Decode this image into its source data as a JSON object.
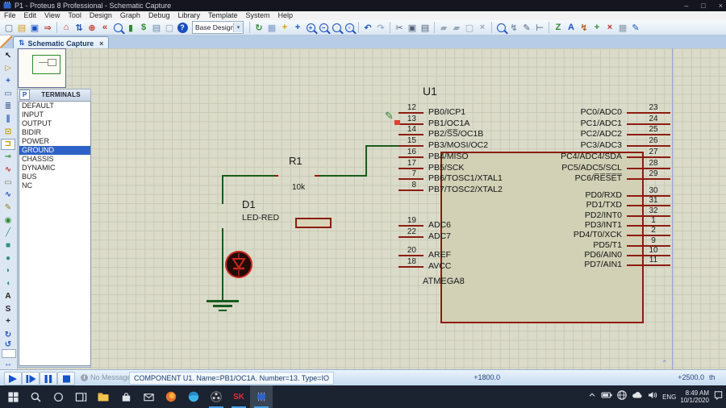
{
  "window": {
    "title": "P1 - Proteus 8 Professional - Schematic Capture",
    "controls": {
      "minimize": "–",
      "maximize": "□",
      "close": "×"
    }
  },
  "menus": [
    "File",
    "Edit",
    "View",
    "Tool",
    "Design",
    "Graph",
    "Debug",
    "Library",
    "Template",
    "System",
    "Help"
  ],
  "toolbar": {
    "design_combo": "Base Design",
    "combo_arrow": "▾",
    "groups_a": [
      [
        {
          "name": "new-design",
          "g": "▢",
          "c": "#5a6a7a"
        },
        {
          "name": "open-design",
          "g": "▤",
          "c": "#d89a10"
        },
        {
          "name": "save-design",
          "g": "▣",
          "c": "#1a4fc0"
        },
        {
          "name": "import-section",
          "g": "⇒",
          "c": "#c03028"
        }
      ],
      [
        {
          "name": "home-page",
          "g": "⌂",
          "c": "#c03028"
        },
        {
          "name": "new-sheet",
          "g": "⇅",
          "c": "#1a4fc0"
        },
        {
          "name": "center-at-cursor",
          "g": "⊕",
          "c": "#c03028"
        },
        {
          "name": "goto-sheet",
          "g": "«",
          "c": "#c03028"
        },
        {
          "name": "find-part",
          "t": "mag",
          "i": ""
        },
        {
          "name": "material-list",
          "g": "▮",
          "c": "#2f8a2f"
        },
        {
          "name": "bill-of-materials",
          "g": "$",
          "c": "#2f8a2f"
        },
        {
          "name": "electrical-rule-check",
          "g": "▤",
          "c": "#6a88aa"
        },
        {
          "name": "netlist-transfer",
          "g": "▢",
          "c": "#8a9ab0"
        },
        {
          "name": "help",
          "t": "help",
          "g": "?"
        }
      ]
    ],
    "groups_b": [
      [
        {
          "name": "redraw",
          "g": "↻",
          "c": "#2f8a2f"
        },
        {
          "name": "toggle-grid",
          "g": "▦",
          "c": "#7a98c8"
        },
        {
          "name": "origin",
          "g": "+",
          "c": "#d89a10"
        },
        {
          "name": "pan",
          "g": "+",
          "c": "#1a4fc0"
        },
        {
          "name": "zoom-in",
          "t": "mag",
          "i": "+"
        },
        {
          "name": "zoom-out",
          "t": "mag",
          "i": "−"
        },
        {
          "name": "zoom-all",
          "t": "mag",
          "i": ""
        },
        {
          "name": "zoom-area",
          "t": "mag",
          "i": "▫"
        }
      ],
      [
        {
          "name": "undo",
          "g": "↶",
          "c": "#1a4fc0"
        },
        {
          "name": "redo",
          "g": "↷",
          "c": "#9ab0c8"
        }
      ],
      [
        {
          "name": "cut",
          "g": "✂",
          "c": "#51617a"
        },
        {
          "name": "copy",
          "g": "▣",
          "c": "#51617a"
        },
        {
          "name": "paste",
          "g": "▤",
          "c": "#51617a"
        }
      ],
      [
        {
          "name": "copy-block",
          "g": "▰",
          "c": "#9aa8b8"
        },
        {
          "name": "move-block",
          "g": "▰",
          "c": "#9aa8b8"
        },
        {
          "name": "rotate-block",
          "g": "▢",
          "c": "#9aa8b8"
        },
        {
          "name": "delete-block",
          "g": "×",
          "c": "#9aa8b8"
        }
      ],
      [
        {
          "name": "search-and-tag",
          "t": "mag",
          "i": ""
        },
        {
          "name": "property-assignment",
          "g": "↯",
          "c": "#7a8aa0"
        },
        {
          "name": "edit-properties",
          "g": "✎",
          "c": "#51617a"
        },
        {
          "name": "design-explorer",
          "g": "⊢",
          "c": "#7a8aa0"
        }
      ],
      [
        {
          "name": "new-root-sheet",
          "g": "Z",
          "c": "#2f8a2f"
        },
        {
          "name": "ascii-data",
          "g": "A",
          "c": "#1a4fc0"
        },
        {
          "name": "zone",
          "g": "↯",
          "c": "#b05a20"
        },
        {
          "name": "add-sheet",
          "g": "+",
          "c": "#2f8a2f"
        },
        {
          "name": "remove-sheet",
          "g": "×",
          "c": "#c03028"
        },
        {
          "name": "exit-to-parent",
          "g": "▦",
          "c": "#8898a8"
        },
        {
          "name": "edit-sheet",
          "g": "✎",
          "c": "#1a4fc0"
        }
      ]
    ]
  },
  "tabbar": {
    "active_tab": "Schematic Capture",
    "tab_icon": "⇅",
    "close": "×"
  },
  "left_tools": [
    {
      "name": "selection-mode",
      "g": "↖",
      "c": "#111"
    },
    {
      "name": "component-mode",
      "g": "▷",
      "c": "#c79a00"
    },
    {
      "name": "junction-dot-mode",
      "g": "+",
      "c": "#1a4fc0"
    },
    {
      "name": "wire-label-mode",
      "g": "▭",
      "c": "#445a88"
    },
    {
      "name": "text-script-mode",
      "g": "≣",
      "c": "#445a88"
    },
    {
      "name": "buses-mode",
      "g": "∥",
      "c": "#1a4fc0"
    },
    {
      "name": "subcircuit-mode",
      "g": "⊡",
      "c": "#c79a00"
    },
    {
      "name": "terminals-mode",
      "g": "⊐",
      "c": "#c79a00",
      "sel": true
    },
    {
      "name": "device-pins-mode",
      "g": "⊸",
      "c": "#2f8a2f"
    },
    {
      "name": "graph-mode",
      "g": "∿",
      "c": "#c03028"
    },
    {
      "name": "tape-recorder-mode",
      "g": "▭",
      "c": "#777"
    },
    {
      "name": "generator-mode",
      "g": "∿",
      "c": "#1a4fc0"
    },
    {
      "name": "voltage-probe-mode",
      "g": "✎",
      "c": "#8a7a20"
    },
    {
      "name": "current-probe-mode",
      "g": "◉",
      "c": "#2f8a2f"
    },
    {
      "name": "2d-line-mode",
      "g": "╱",
      "c": "#2f8f7f"
    },
    {
      "name": "2d-box-mode",
      "g": "■",
      "c": "#2f8f7f"
    },
    {
      "name": "2d-circle-mode",
      "g": "●",
      "c": "#2f8f7f"
    },
    {
      "name": "2d-arc-mode",
      "g": "◗",
      "c": "#2f8f7f"
    },
    {
      "name": "2d-path-mode",
      "g": "◖",
      "c": "#2f8f7f"
    },
    {
      "name": "2d-text-mode",
      "g": "A",
      "c": "#222"
    },
    {
      "name": "2d-symbol-mode",
      "g": "S",
      "c": "#223"
    },
    {
      "name": "2d-marker-mode",
      "g": "+",
      "c": "#223"
    }
  ],
  "rotate_tools": {
    "cw": "↻",
    "ccw": "↺",
    "angle_value": "",
    "flip_h": "↔",
    "flip_v": "↕",
    "color": "#1a4fc0"
  },
  "object_selector": {
    "pick_button": "P",
    "title": "TERMINALS",
    "items": [
      "DEFAULT",
      "INPUT",
      "OUTPUT",
      "BIDIR",
      "POWER",
      "GROUND",
      "CHASSIS",
      "DYNAMIC",
      "BUS",
      "NC"
    ],
    "selected": "GROUND"
  },
  "canvas": {
    "chip": {
      "ref": "U1",
      "part_name": "ATMEGA8",
      "left_pins": [
        {
          "num": "12",
          "label": "PB0/ICP1"
        },
        {
          "num": "13",
          "label": "PB1/OC1A"
        },
        {
          "num": "14",
          "label": "PB2/S̅S̅/OC1B"
        },
        {
          "num": "15",
          "label": "PB3/MOSI/OC2"
        },
        {
          "num": "16",
          "label": "PB4/MISO"
        },
        {
          "num": "17",
          "label": "PB5/SCK"
        },
        {
          "num": "7",
          "label": "PB6/TOSC1/XTAL1"
        },
        {
          "num": "8",
          "label": "PB7/TOSC2/XTAL2"
        }
      ],
      "left_pins_adc": [
        {
          "num": "19",
          "label": "ADC6"
        },
        {
          "num": "22",
          "label": "ADC7"
        }
      ],
      "left_pins_ref": [
        {
          "num": "20",
          "label": "AREF"
        },
        {
          "num": "18",
          "label": "AVCC"
        }
      ],
      "right_pins_pc": [
        {
          "num": "23",
          "label": "PC0/ADC0"
        },
        {
          "num": "24",
          "label": "PC1/ADC1"
        },
        {
          "num": "25",
          "label": "PC2/ADC2"
        },
        {
          "num": "26",
          "label": "PC3/ADC3"
        },
        {
          "num": "27",
          "label": "PC4/ADC4/SDA"
        },
        {
          "num": "28",
          "label": "PC5/ADC5/SCL"
        },
        {
          "num": "29",
          "label": "PC6/R̅E̅S̅E̅T̅"
        }
      ],
      "right_pins_pd": [
        {
          "num": "30",
          "label": "PD0/RXD"
        },
        {
          "num": "31",
          "label": "PD1/TXD"
        },
        {
          "num": "32",
          "label": "PD2/INT0"
        },
        {
          "num": "1",
          "label": "PD3/INT1"
        },
        {
          "num": "2",
          "label": "PD4/T0/XCK"
        },
        {
          "num": "9",
          "label": "PD5/T1"
        },
        {
          "num": "10",
          "label": "PD6/AIN0"
        },
        {
          "num": "11",
          "label": "PD7/AIN1"
        }
      ]
    },
    "resistor": {
      "ref": "R1",
      "value": "10k"
    },
    "led": {
      "ref": "D1",
      "value": "LED-RED"
    }
  },
  "statusbar": {
    "no_messages": "No Messages",
    "info_glyph": "i",
    "message": "COMPONENT U1. Name=PB1/OC1A. Number=13. Type=IO",
    "coord_x": "+1800.0",
    "coord_y": "+2500.0",
    "units": "th"
  },
  "taskbar": {
    "items": [
      {
        "name": "start"
      },
      {
        "name": "search"
      },
      {
        "name": "cortana"
      },
      {
        "name": "task-view"
      },
      {
        "name": "file-explorer"
      },
      {
        "name": "store"
      },
      {
        "name": "mail"
      },
      {
        "name": "firefox"
      },
      {
        "name": "edge"
      },
      {
        "name": "obs",
        "open": true
      },
      {
        "name": "sk-app",
        "label": "SK",
        "open": true
      },
      {
        "name": "proteus",
        "active": true
      }
    ],
    "tray": {
      "lang": "ENG",
      "time": "8:49 AM",
      "date": "10/1/2020"
    }
  },
  "colors": {
    "wire": "#1a5c1d",
    "component_outline": "#8c1c10",
    "canvas": "#dadbc9",
    "selection": "#2f62c6",
    "led_ring": "#c8281e",
    "accent_blue": "#1a4fc0"
  }
}
